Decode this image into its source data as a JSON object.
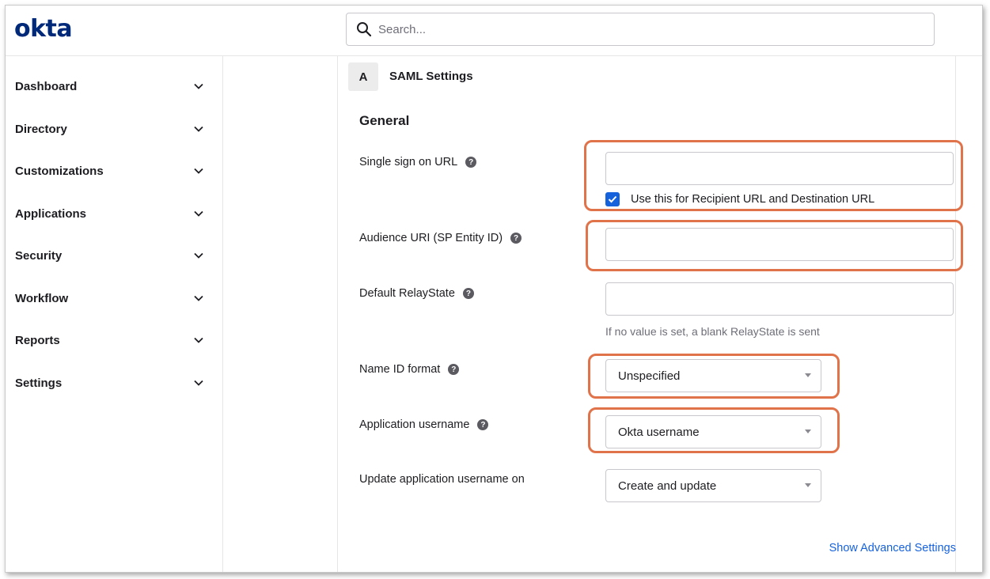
{
  "brand": {
    "logo_text": "okta",
    "logo_color": "#00297a"
  },
  "search": {
    "placeholder": "Search..."
  },
  "sidebar": {
    "items": [
      {
        "label": "Dashboard"
      },
      {
        "label": "Directory"
      },
      {
        "label": "Customizations"
      },
      {
        "label": "Applications"
      },
      {
        "label": "Security"
      },
      {
        "label": "Workflow"
      },
      {
        "label": "Reports"
      },
      {
        "label": "Settings"
      }
    ]
  },
  "step": {
    "badge": "A",
    "title": "SAML Settings"
  },
  "section": {
    "title": "General"
  },
  "fields": {
    "sso_url": {
      "label": "Single sign on URL",
      "value": ""
    },
    "recipient_checkbox": {
      "label": "Use this for Recipient URL and Destination URL",
      "checked": true
    },
    "audience_uri": {
      "label": "Audience URI (SP Entity ID)",
      "value": ""
    },
    "relay_state": {
      "label": "Default RelayState",
      "value": "",
      "hint": "If no value is set, a blank RelayState is sent"
    },
    "name_id_format": {
      "label": "Name ID format",
      "selected": "Unspecified"
    },
    "app_username": {
      "label": "Application username",
      "selected": "Okta username"
    },
    "update_username_on": {
      "label": "Update application username on",
      "selected": "Create and update"
    }
  },
  "help_icon_glyph": "?",
  "advanced_link": "Show Advanced Settings",
  "colors": {
    "accent": "#1662dd",
    "highlight": "#e0734a",
    "text": "#1d1d21"
  }
}
